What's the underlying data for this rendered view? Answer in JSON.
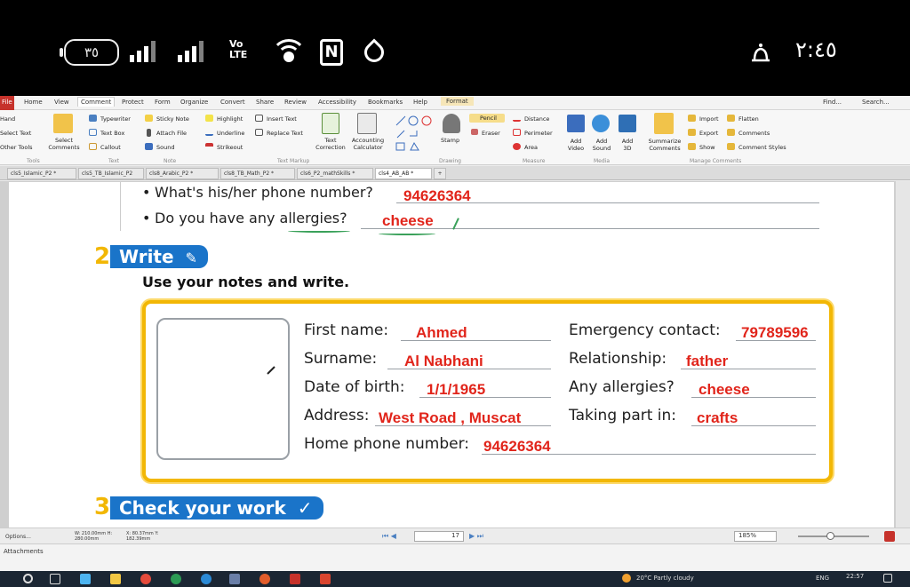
{
  "phone_status": {
    "battery": "٣٥",
    "network": "VoLTE LTE",
    "time": "٢:٤٥"
  },
  "menubar": {
    "items": [
      "File",
      "Home",
      "View",
      "Comment",
      "Protect",
      "Form",
      "Organize",
      "Convert",
      "Share",
      "Review",
      "Accessibility",
      "Bookmarks",
      "Help",
      "Format"
    ],
    "active": "Comment",
    "find": "Find...",
    "search": "Search..."
  },
  "ribbon": {
    "tools": {
      "hand": "Hand",
      "select_text": "Select Text",
      "other_tools": "Other Tools",
      "select_comments": "Select Comments",
      "group": "Tools"
    },
    "text": {
      "typewriter": "Typewriter",
      "textbox": "Text Box",
      "callout": "Callout",
      "group": "Text"
    },
    "note": {
      "sticky": "Sticky Note",
      "attach": "Attach File",
      "sound": "Sound",
      "group": "Note"
    },
    "markup": {
      "highlight": "Highlight",
      "underline": "Underline",
      "strikeout": "Strikeout",
      "insert": "Insert Text",
      "replace": "Replace Text",
      "text_correction": "Text Correction",
      "accounting": "Accounting Calculator",
      "group": "Text Markup"
    },
    "drawing": {
      "stamp": "Stamp",
      "pencil": "Pencil",
      "eraser": "Eraser",
      "group": "Drawing"
    },
    "measure": {
      "distance": "Distance",
      "perimeter": "Perimeter",
      "area": "Area",
      "group": "Measure"
    },
    "media": {
      "video": "Add Video",
      "sound": "Add Sound",
      "add3d": "Add 3D",
      "group": "Media"
    },
    "manage": {
      "summarize": "Summarize Comments",
      "import": "Import",
      "export": "Export",
      "show": "Show",
      "flatten": "Flatten",
      "comments": "Comments",
      "styles": "Comment Styles",
      "group": "Manage Comments"
    }
  },
  "tabs": [
    "cls5_Islamic_P2 *",
    "cls5_TB_Islamic_P2",
    "cls8_Arabic_P2 *",
    "cls8_TB_Math_P2 *",
    "cls6_P2_mathSkills *",
    "cls4_AB_AB *"
  ],
  "active_tab": 5,
  "doc": {
    "q_phone": "What's his/her phone number?",
    "a_phone": "94626364",
    "q_allergy": "Do you have any allergies?",
    "a_allergy": "cheese",
    "sec2_num": "2",
    "sec2_title": "Write",
    "instruction": "Use your notes and write.",
    "form": {
      "first_name_label": "First name:",
      "first_name": "Ahmed",
      "surname_label": "Surname:",
      "surname": "Al Nabhani",
      "dob_label": "Date of birth:",
      "dob": "1/1/1965",
      "address_label": "Address:",
      "address": "West Road , Muscat",
      "home_phone_label": "Home phone number:",
      "home_phone": "94626364",
      "emergency_label": "Emergency contact:",
      "emergency": "79789596",
      "relationship_label": "Relationship:",
      "relationship": "father",
      "allergies_label": "Any allergies?",
      "allergies": "cheese",
      "taking_part_label": "Taking part in:",
      "taking_part": "crafts"
    },
    "sec3_num": "3",
    "sec3_title": "Check your work"
  },
  "status": {
    "options": "Options...",
    "size": "W: 210.00mm H: 280.00mm",
    "coords": "X: 80.37mm Y: 182.39mm",
    "page": "17",
    "zoom": "185%"
  },
  "attachments": "Attachments",
  "taskbar": {
    "weather": "20°C Partly cloudy",
    "lang": "ENG",
    "clock": "22:57"
  },
  "colors": {
    "answer": "#e1251b",
    "section": "#1a74c9",
    "frame": "#f2b705"
  }
}
